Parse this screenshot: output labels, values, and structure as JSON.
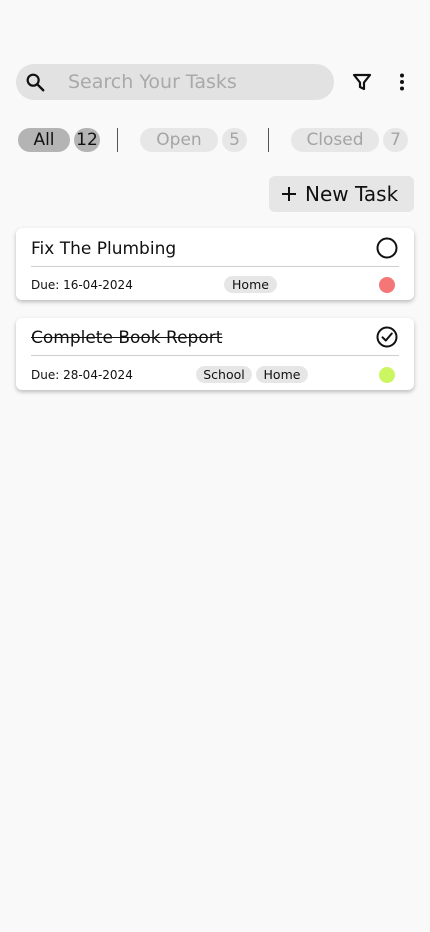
{
  "search": {
    "placeholder": "Search Your Tasks",
    "icon": "search-icon"
  },
  "toolbar": {
    "filter_icon": "filter-icon",
    "more_icon": "more-vertical-icon"
  },
  "filters": {
    "all": {
      "label": "All",
      "count": "12",
      "selected": true
    },
    "open": {
      "label": "Open",
      "count": "5",
      "selected": false
    },
    "closed": {
      "label": "Closed",
      "count": "7",
      "selected": false
    }
  },
  "new_task": {
    "label": "New Task",
    "icon": "plus-icon"
  },
  "tasks": [
    {
      "title": "Fix The Plumbing",
      "completed": false,
      "due": "Due: 16-04-2024",
      "tags": [
        "Home"
      ],
      "priority_color": "#f47676"
    },
    {
      "title": "Complete Book Report",
      "completed": true,
      "due": "Due: 28-04-2024",
      "tags": [
        "School",
        "Home"
      ],
      "priority_color": "#ccf562"
    }
  ],
  "colors": {
    "background": "#f9f9f9",
    "chip_selected": "#b4b4b4",
    "chip_unselected": "#e7e7e7",
    "chip_unselected_text": "#a4a4a4",
    "search_bg": "#e2e2e2"
  }
}
